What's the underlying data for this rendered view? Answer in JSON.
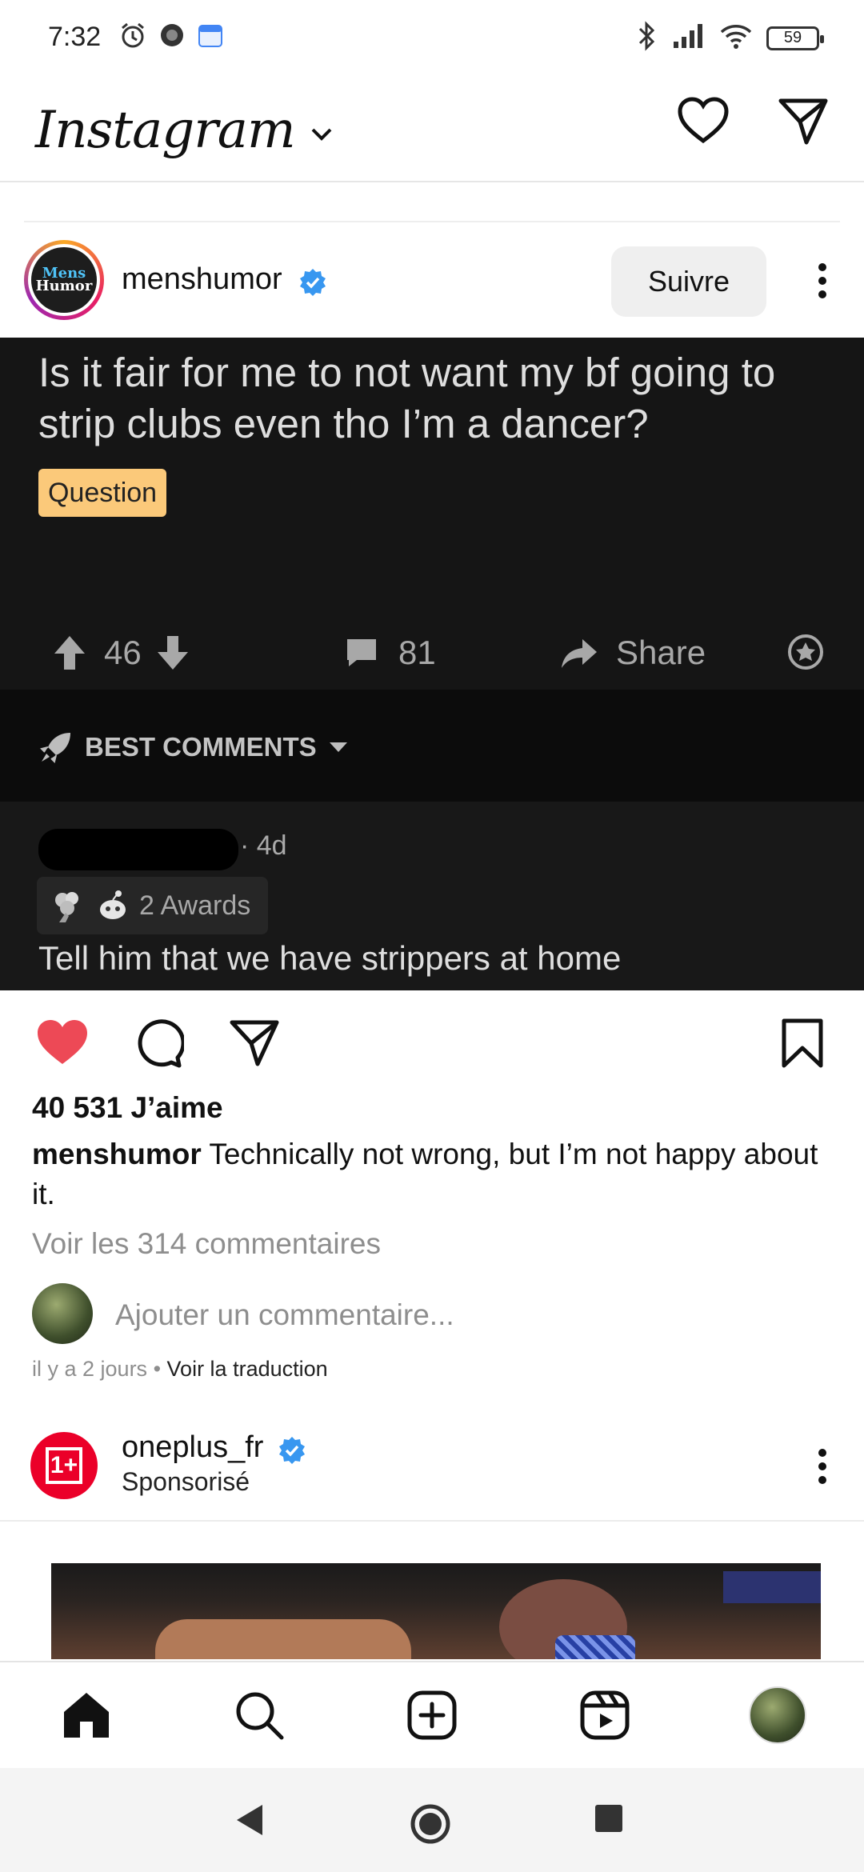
{
  "status_bar": {
    "time": "7:32",
    "battery": "59"
  },
  "header": {
    "logo": "Instagram"
  },
  "post": {
    "username": "menshumor",
    "avatar_text_top": "Mens",
    "avatar_text_bottom": "Humor",
    "follow_label": "Suivre",
    "image": {
      "question": "Is it fair for me to not want my bf going to strip clubs even tho I’m a dancer?",
      "tag": "Question",
      "upvotes": "46",
      "comments": "81",
      "share": "Share",
      "best_comments": "BEST COMMENTS",
      "comment_age": "· 4d",
      "awards": "2 Awards",
      "comment_text": "Tell him that we have strippers at home"
    },
    "likes": "40 531 J’aime",
    "caption_user": "menshumor",
    "caption_text": "Technically not wrong, but I’m not happy about it.",
    "view_comments": "Voir les 314 commentaires",
    "add_comment_placeholder": "Ajouter un commentaire...",
    "time_ago": "il y a 2 jours",
    "separator": " • ",
    "translate": "Voir la traduction"
  },
  "sponsored": {
    "username": "oneplus_fr",
    "label": "Sponsorisé",
    "logo_text": "1+"
  },
  "colors": {
    "like_red": "#ed4956",
    "verified_blue": "#3897f0",
    "tag_yellow": "#fbc97a",
    "oneplus_red": "#eb0029"
  },
  "icons": {
    "status": [
      "alarm-icon",
      "app-icon",
      "calendar-icon",
      "bluetooth-icon",
      "signal-icon",
      "wifi-icon",
      "battery-icon"
    ],
    "header": [
      "heart-icon",
      "direct-message-icon"
    ],
    "post_actions": [
      "heart-filled-icon",
      "comment-icon",
      "share-icon",
      "bookmark-icon"
    ],
    "bottom_nav": [
      "home-icon",
      "search-icon",
      "create-icon",
      "reels-icon",
      "profile-avatar"
    ],
    "system_nav": [
      "back-icon",
      "home-circle-icon",
      "recents-icon"
    ]
  }
}
